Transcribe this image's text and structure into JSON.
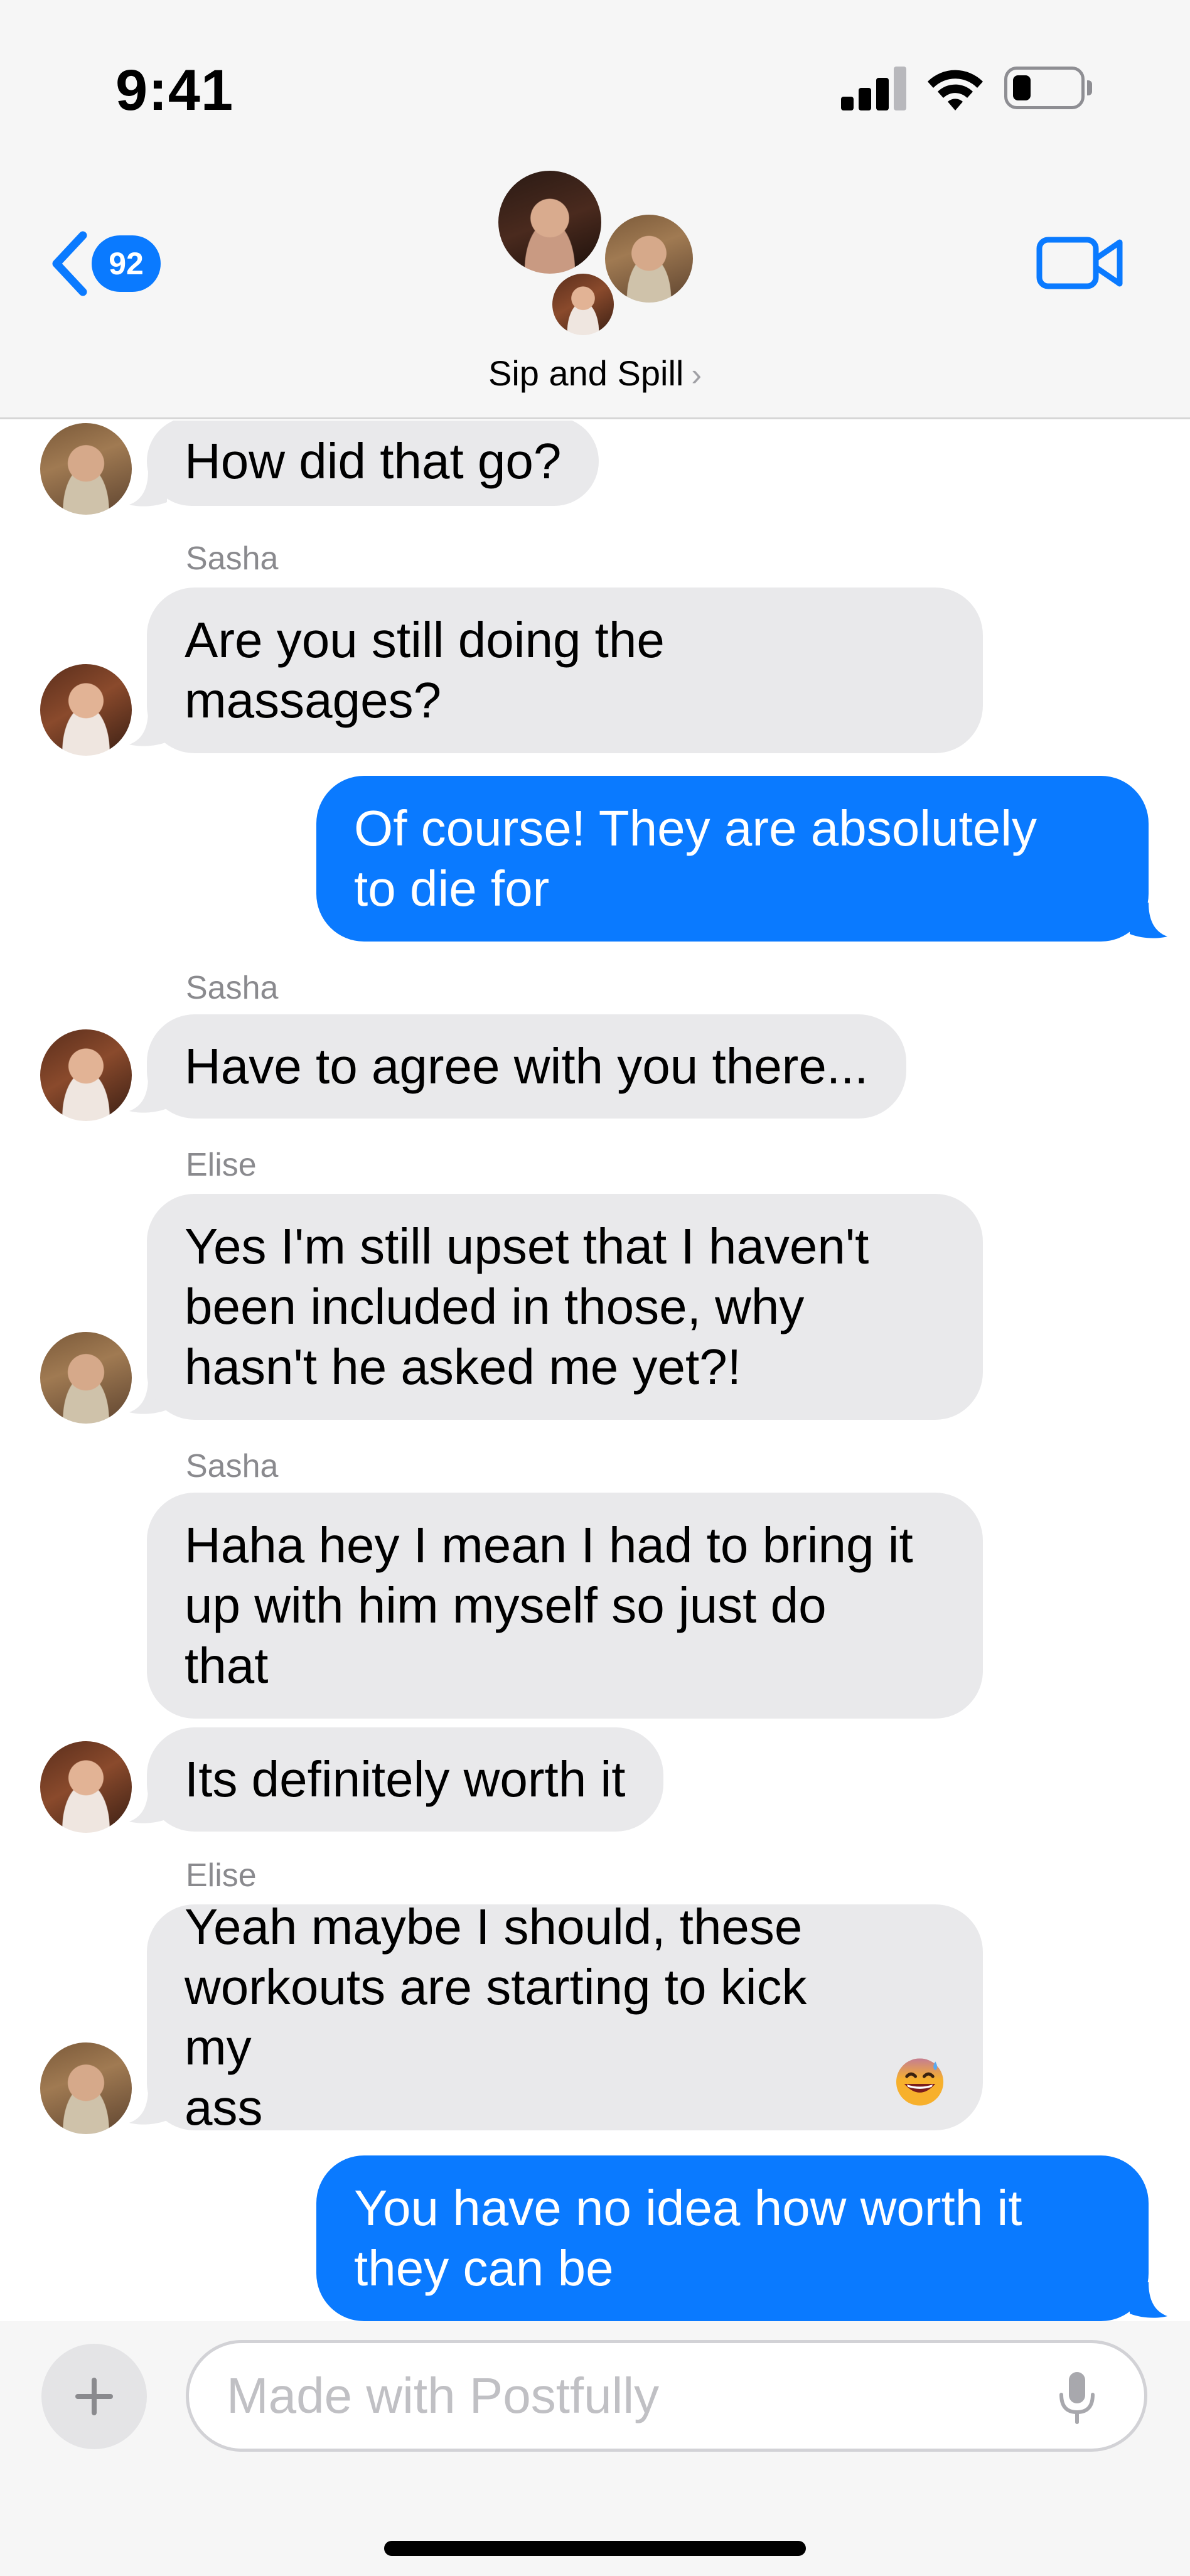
{
  "status_bar": {
    "time": "9:41"
  },
  "header": {
    "back_badge": "92",
    "group_name": "Sip and Spill",
    "group_chevron": "›"
  },
  "messages": [
    {
      "direction": "incoming",
      "sender": "",
      "text": "How did that go?",
      "avatar": "elise"
    },
    {
      "direction": "incoming",
      "sender": "Sasha",
      "text": "Are you still doing the\nmassages?",
      "avatar": "sasha"
    },
    {
      "direction": "outgoing",
      "text": "Of course! They are absolutely\nto die for"
    },
    {
      "direction": "incoming",
      "sender": "Sasha",
      "text": "Have to agree with you there...",
      "avatar": "sasha"
    },
    {
      "direction": "incoming",
      "sender": "Elise",
      "text": "Yes I'm still upset that I haven't\nbeen included in those, why\nhasn't he asked me yet?!",
      "avatar": "elise"
    },
    {
      "direction": "incoming",
      "sender": "Sasha",
      "text": "Haha hey I mean I had to bring it\nup with him myself so just do\nthat",
      "avatar": ""
    },
    {
      "direction": "incoming",
      "sender": "",
      "text": "Its definitely worth it",
      "avatar": "sasha"
    },
    {
      "direction": "incoming",
      "sender": "Elise",
      "text": "Yeah maybe I should, these\nworkouts are starting to kick my\nass",
      "emoji": "grinning-sweat-emoji",
      "avatar": "elise"
    },
    {
      "direction": "outgoing",
      "text": "You have no idea how worth it\nthey can be"
    }
  ],
  "composer": {
    "placeholder": "Made with Postfully"
  },
  "colors": {
    "imessage_blue": "#0a7aff",
    "incoming_bubble": "#e9e9eb",
    "header_bg": "#f6f6f6"
  },
  "icons": [
    "back-chevron-icon",
    "video-call-icon",
    "plus-icon",
    "microphone-icon",
    "cellular-signal-icon",
    "wifi-icon",
    "battery-icon"
  ]
}
